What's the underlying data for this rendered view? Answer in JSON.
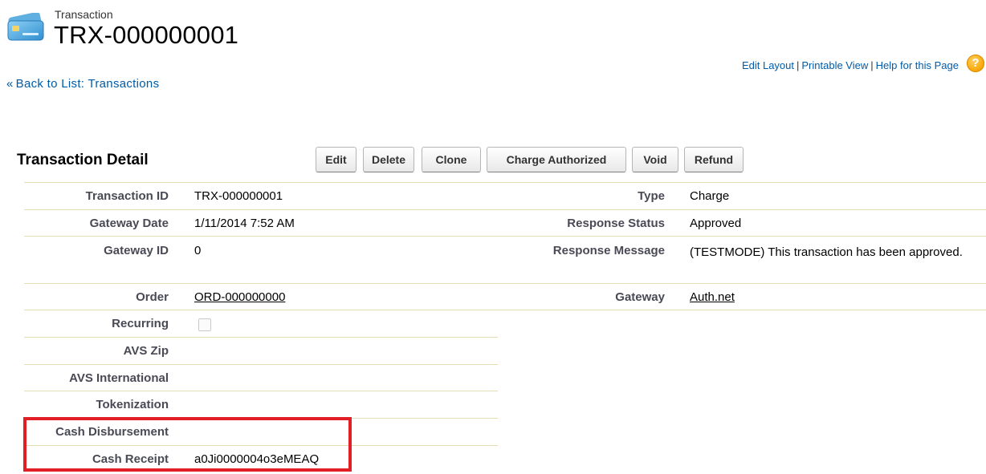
{
  "header": {
    "object_type": "Transaction",
    "record_name": "TRX-000000001",
    "icon": "credit-card-icon"
  },
  "top_links": {
    "edit_layout": "Edit Layout",
    "printable_view": "Printable View",
    "help": "Help for this Page",
    "separator": "|",
    "help_icon": "?"
  },
  "back_link": {
    "chevron": "«",
    "label": "Back to List: Transactions"
  },
  "detail": {
    "title": "Transaction Detail",
    "buttons": {
      "edit": "Edit",
      "delete": "Delete",
      "clone": "Clone",
      "charge_authorized": "Charge Authorized",
      "void": "Void",
      "refund": "Refund"
    },
    "fields": {
      "transaction_id": {
        "label": "Transaction ID",
        "value": "TRX-000000001"
      },
      "gateway_date": {
        "label": "Gateway Date",
        "value": "1/11/2014 7:52 AM"
      },
      "gateway_id": {
        "label": "Gateway ID",
        "value": "0"
      },
      "order": {
        "label": "Order",
        "value": "ORD-000000000"
      },
      "recurring": {
        "label": "Recurring",
        "checked": false
      },
      "avs_zip": {
        "label": "AVS Zip",
        "value": ""
      },
      "avs_international": {
        "label": "AVS International",
        "value": ""
      },
      "tokenization": {
        "label": "Tokenization",
        "value": ""
      },
      "cash_disbursement": {
        "label": "Cash Disbursement",
        "value": ""
      },
      "cash_receipt": {
        "label": "Cash Receipt",
        "value": "a0Ji0000004o3eMEAQ"
      },
      "type": {
        "label": "Type",
        "value": "Charge"
      },
      "response_status": {
        "label": "Response Status",
        "value": "Approved"
      },
      "response_message": {
        "label": "Response Message",
        "value": "(TESTMODE) This transaction has been approved."
      },
      "gateway": {
        "label": "Gateway",
        "value": "Auth.net"
      }
    }
  },
  "colors": {
    "link": "#015ba7",
    "divider": "#e3deb8",
    "highlight": "#e21f26",
    "label": "#4a4a56"
  }
}
